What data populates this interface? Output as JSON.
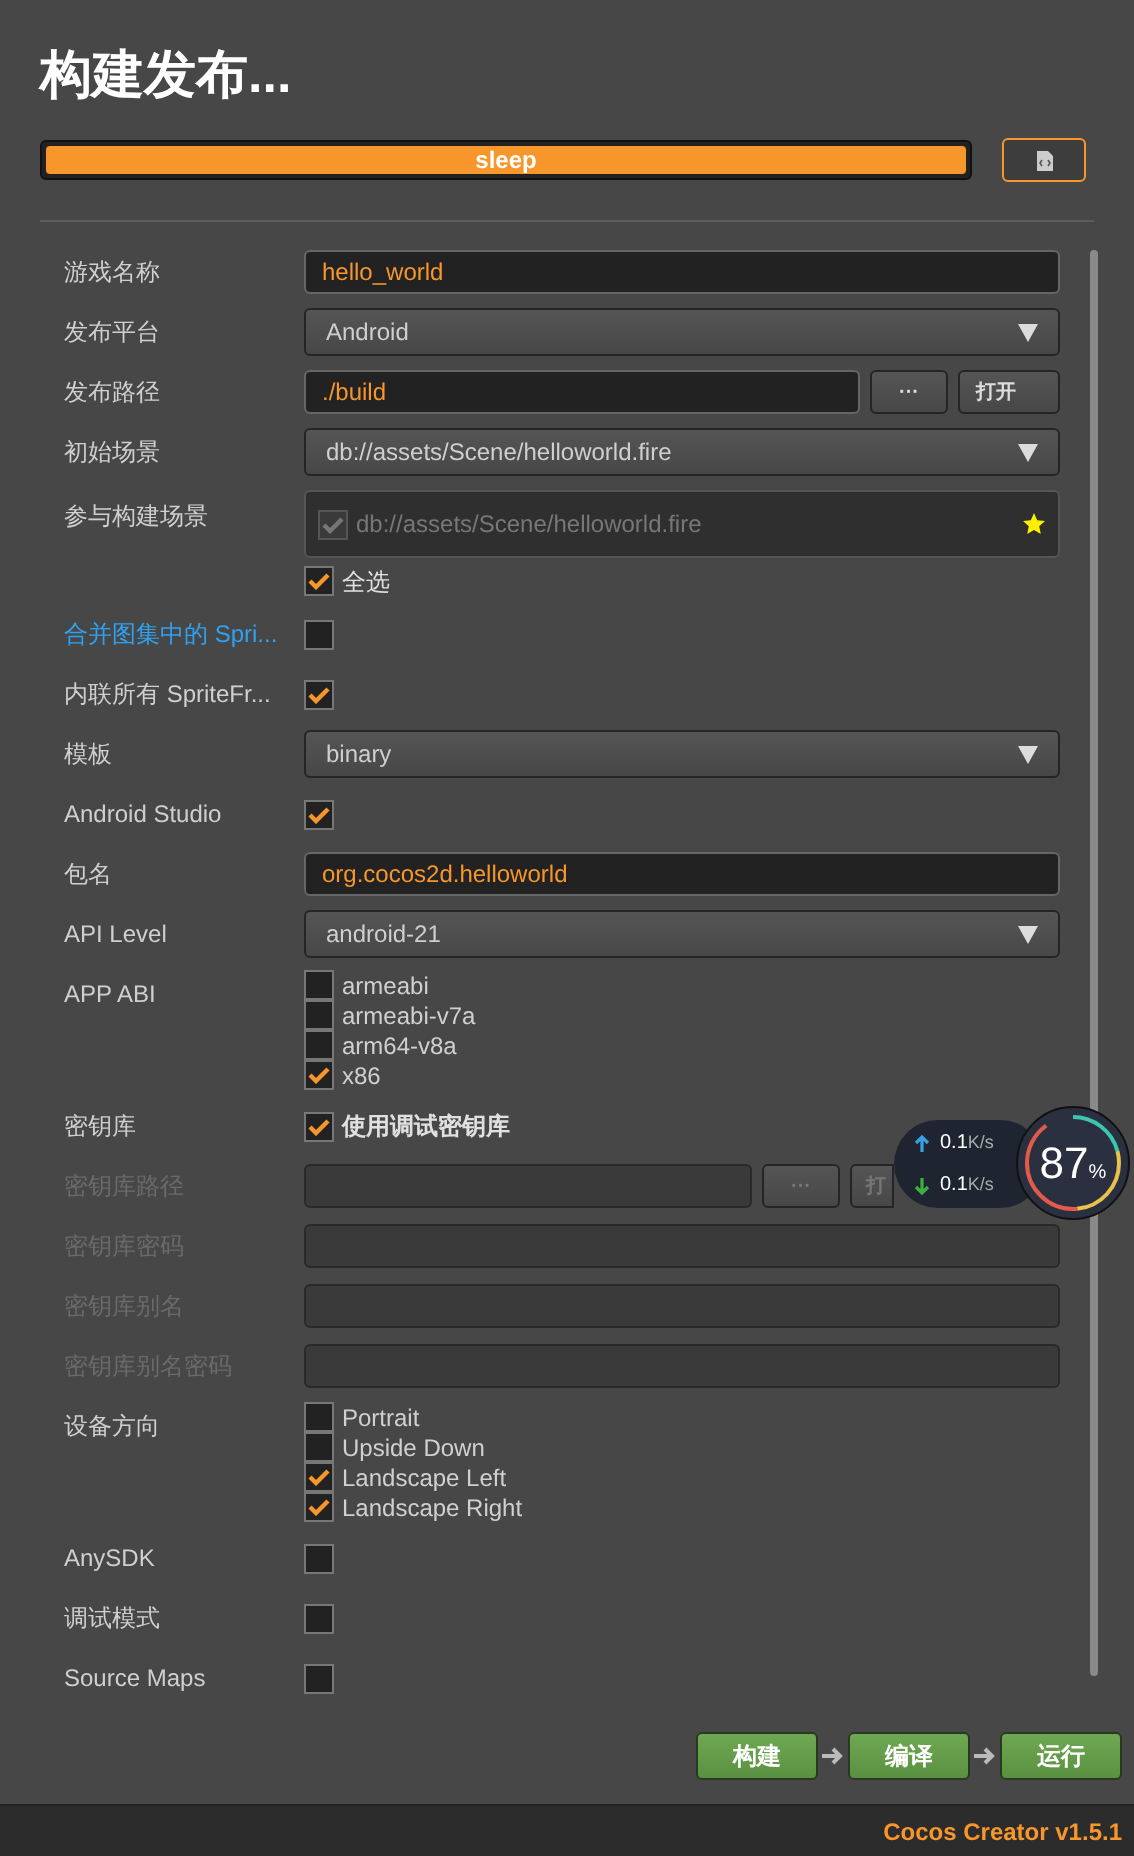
{
  "title": "构建发布...",
  "progress": {
    "label": "sleep",
    "level": 1
  },
  "form": [
    {
      "kind": "input",
      "label": "游戏名称",
      "value": "hello_world",
      "disabled": false,
      "highlighted": false
    },
    {
      "kind": "select",
      "label": "发布平台",
      "value": "Android",
      "disabled": false,
      "highlighted": false
    },
    {
      "kind": "path",
      "label": "发布路径",
      "value": "./build",
      "buttons": [
        "···",
        "打开"
      ],
      "disabled": false,
      "highlighted": false
    },
    {
      "kind": "select",
      "label": "初始场景",
      "value": "db://assets/Scene/helloworld.fire",
      "disabled": false,
      "highlighted": false
    },
    {
      "kind": "scenes",
      "label": "参与构建场景",
      "scenes": [
        {
          "path": "db://assets/Scene/helloworld.fire",
          "checked": true,
          "starred": true
        }
      ],
      "select_all": {
        "label": "全选",
        "checked": true
      },
      "disabled": false,
      "highlighted": false
    },
    {
      "kind": "checkbox",
      "label": "合并图集中的 Spri...",
      "checked": false,
      "disabled": false,
      "highlighted": true
    },
    {
      "kind": "checkbox",
      "label": "内联所有 SpriteFr...",
      "checked": true,
      "disabled": false,
      "highlighted": false
    },
    {
      "kind": "select",
      "label": "模板",
      "value": "binary",
      "disabled": false,
      "highlighted": false
    },
    {
      "kind": "checkbox",
      "label": "Android Studio",
      "checked": true,
      "disabled": false,
      "highlighted": false
    },
    {
      "kind": "input",
      "label": "包名",
      "value": "org.cocos2d.helloworld",
      "disabled": false,
      "highlighted": false
    },
    {
      "kind": "select",
      "label": "API Level",
      "value": "android-21",
      "disabled": false,
      "highlighted": false
    },
    {
      "kind": "checklist",
      "label": "APP ABI",
      "options": [
        {
          "label": "armeabi",
          "checked": false
        },
        {
          "label": "armeabi-v7a",
          "checked": false
        },
        {
          "label": "arm64-v8a",
          "checked": false
        },
        {
          "label": "x86",
          "checked": true
        }
      ],
      "disabled": false,
      "highlighted": false
    },
    {
      "kind": "checkbox",
      "label": "密钥库",
      "text": "使用调试密钥库",
      "checked": true,
      "disabled": false,
      "highlighted": false
    },
    {
      "kind": "path",
      "label": "密钥库路径",
      "buttons": [
        "···",
        "打"
      ],
      "disabled": true,
      "highlighted": false
    },
    {
      "kind": "input",
      "label": "密钥库密码",
      "disabled": true,
      "highlighted": false
    },
    {
      "kind": "input",
      "label": "密钥库别名",
      "disabled": true,
      "highlighted": false
    },
    {
      "kind": "input",
      "label": "密钥库别名密码",
      "disabled": true,
      "highlighted": false
    },
    {
      "kind": "checklist",
      "label": "设备方向",
      "options": [
        {
          "label": "Portrait",
          "checked": false
        },
        {
          "label": "Upside Down",
          "checked": false
        },
        {
          "label": "Landscape Left",
          "checked": true
        },
        {
          "label": "Landscape Right",
          "checked": true
        }
      ],
      "disabled": false,
      "highlighted": false
    },
    {
      "kind": "checkbox",
      "label": "AnySDK",
      "checked": false,
      "disabled": false,
      "highlighted": false
    },
    {
      "kind": "checkbox",
      "label": "调试模式",
      "checked": false,
      "disabled": false,
      "highlighted": false
    },
    {
      "kind": "checkbox",
      "label": "Source Maps",
      "checked": false,
      "disabled": false,
      "highlighted": false
    }
  ],
  "actions": [
    "构建",
    "编译",
    "运行"
  ],
  "net_monitor": {
    "upload": "0.1",
    "upload_unit": "K/s",
    "download": "0.1",
    "download_unit": "K/s",
    "percent": "87",
    "percent_unit": "%"
  },
  "footer": "Cocos Creator v1.5.1"
}
